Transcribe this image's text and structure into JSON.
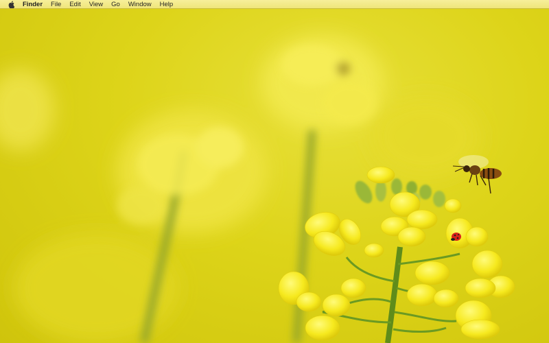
{
  "menubar": {
    "apple_icon": "apple-logo-icon",
    "app_name": "Finder",
    "items": [
      "File",
      "Edit",
      "View",
      "Go",
      "Window",
      "Help"
    ]
  },
  "desktop": {
    "wallpaper": "yellow-rapeseed-flowers-with-bee-and-ladybug"
  },
  "colors": {
    "menubar_bg": "#f2e97f",
    "wallpaper_bg": "#ddd419",
    "flower": "#f2e51f",
    "stem": "#6f9a1e"
  }
}
